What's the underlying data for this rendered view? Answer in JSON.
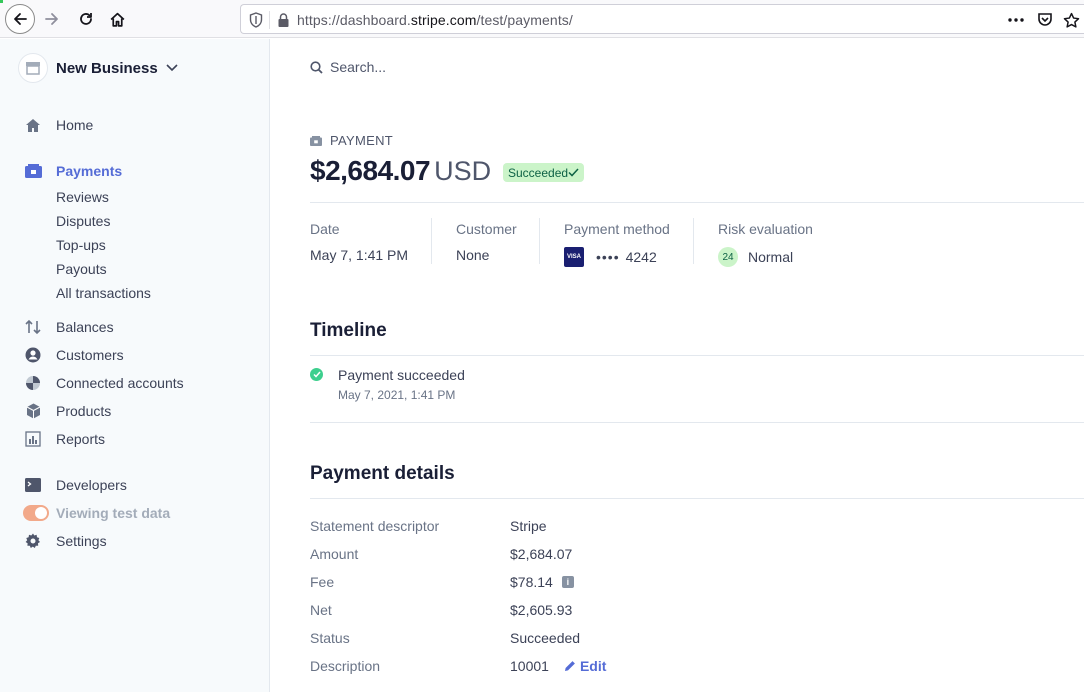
{
  "browser": {
    "url_prefix": "https://dashboard.",
    "url_domain": "stripe.com",
    "url_path": "/test/payments/"
  },
  "sidebar": {
    "business_name": "New Business",
    "items": {
      "home": "Home",
      "payments": "Payments",
      "balances": "Balances",
      "customers": "Customers",
      "connected_accounts": "Connected accounts",
      "products": "Products",
      "reports": "Reports",
      "developers": "Developers",
      "test_data": "Viewing test data",
      "settings": "Settings"
    },
    "payments_sub": {
      "reviews": "Reviews",
      "disputes": "Disputes",
      "topups": "Top-ups",
      "payouts": "Payouts",
      "all_transactions": "All transactions"
    },
    "accent_color": "#556cd6"
  },
  "search": {
    "placeholder": "Search..."
  },
  "payment": {
    "label": "PAYMENT",
    "amount": "$2,684.07",
    "currency": "USD",
    "status_badge": "Succeeded",
    "meta": {
      "date_label": "Date",
      "date_value": "May 7, 1:41 PM",
      "customer_label": "Customer",
      "customer_value": "None",
      "method_label": "Payment method",
      "card_brand": "VISA",
      "card_dots": "••••",
      "card_last4": "4242",
      "risk_label": "Risk evaluation",
      "risk_score": "24",
      "risk_level": "Normal"
    }
  },
  "timeline": {
    "title": "Timeline",
    "events": [
      {
        "title": "Payment succeeded",
        "date": "May 7, 2021, 1:41 PM"
      }
    ]
  },
  "details": {
    "title": "Payment details",
    "statement_descriptor_label": "Statement descriptor",
    "statement_descriptor_value": "Stripe",
    "amount_label": "Amount",
    "amount_value": "$2,684.07",
    "fee_label": "Fee",
    "fee_value": "$78.14",
    "net_label": "Net",
    "net_value": "$2,605.93",
    "status_label": "Status",
    "status_value": "Succeeded",
    "description_label": "Description",
    "description_value": "10001",
    "edit_label": "Edit"
  }
}
